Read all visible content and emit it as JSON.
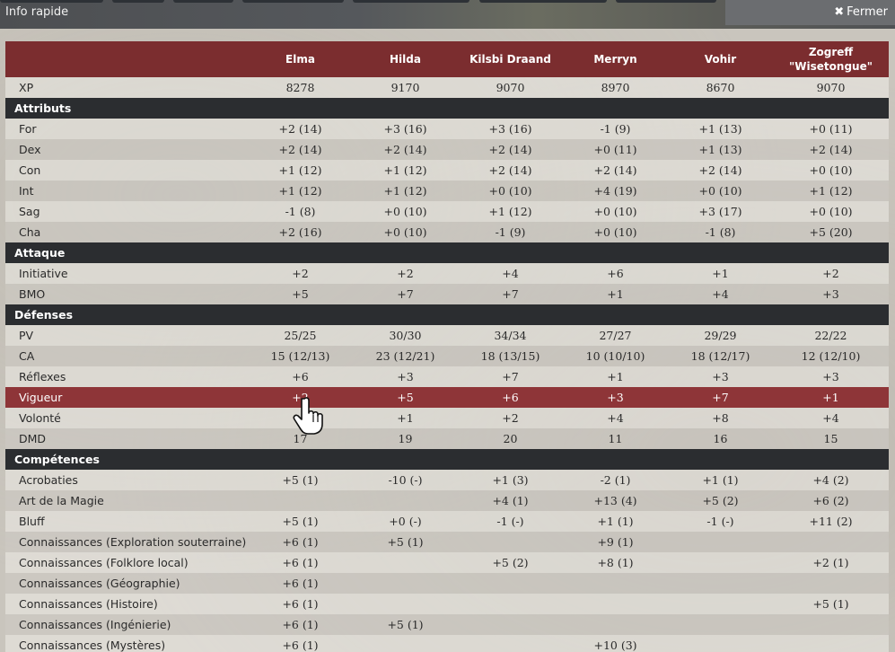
{
  "window": {
    "title": "Info rapide",
    "close_label": "Fermer"
  },
  "table": {
    "columns": [
      "Elma",
      "Hilda",
      "Kilsbi Draand",
      "Merryn",
      "Vohir",
      "Zogreff \"Wisetongue\""
    ],
    "rows": [
      {
        "type": "data",
        "label": "XP",
        "values": [
          "8278",
          "9170",
          "9070",
          "8970",
          "8670",
          "9070"
        ]
      },
      {
        "type": "section",
        "label": "Attributs"
      },
      {
        "type": "data",
        "label": "For",
        "values": [
          "+2 (14)",
          "+3 (16)",
          "+3 (16)",
          "-1 (9)",
          "+1 (13)",
          "+0 (11)"
        ]
      },
      {
        "type": "data",
        "label": "Dex",
        "values": [
          "+2 (14)",
          "+2 (14)",
          "+2 (14)",
          "+0 (11)",
          "+1 (13)",
          "+2 (14)"
        ]
      },
      {
        "type": "data",
        "label": "Con",
        "values": [
          "+1 (12)",
          "+1 (12)",
          "+2 (14)",
          "+2 (14)",
          "+2 (14)",
          "+0 (10)"
        ]
      },
      {
        "type": "data",
        "label": "Int",
        "values": [
          "+1 (12)",
          "+1 (12)",
          "+0 (10)",
          "+4 (19)",
          "+0 (10)",
          "+1 (12)"
        ]
      },
      {
        "type": "data",
        "label": "Sag",
        "values": [
          "-1 (8)",
          "+0 (10)",
          "+1 (12)",
          "+0 (10)",
          "+3 (17)",
          "+0 (10)"
        ]
      },
      {
        "type": "data",
        "label": "Cha",
        "values": [
          "+2 (16)",
          "+0 (10)",
          "-1 (9)",
          "+0 (10)",
          "-1 (8)",
          "+5 (20)"
        ]
      },
      {
        "type": "section",
        "label": "Attaque"
      },
      {
        "type": "data",
        "label": "Initiative",
        "values": [
          "+2",
          "+2",
          "+4",
          "+6",
          "+1",
          "+2"
        ]
      },
      {
        "type": "data",
        "label": "BMO",
        "values": [
          "+5",
          "+7",
          "+7",
          "+1",
          "+4",
          "+3"
        ]
      },
      {
        "type": "section",
        "label": "Défenses"
      },
      {
        "type": "data",
        "label": "PV",
        "values": [
          "25/25",
          "30/30",
          "34/34",
          "27/27",
          "29/29",
          "22/22"
        ]
      },
      {
        "type": "data",
        "label": "CA",
        "values": [
          "15 (12/13)",
          "23 (12/21)",
          "18 (13/15)",
          "10 (10/10)",
          "18 (12/17)",
          "12 (12/10)"
        ]
      },
      {
        "type": "data",
        "label": "Réflexes",
        "values": [
          "+6",
          "+3",
          "+7",
          "+1",
          "+3",
          "+3"
        ]
      },
      {
        "type": "data",
        "label": "Vigueur",
        "highlight": true,
        "values": [
          "+2",
          "+5",
          "+6",
          "+3",
          "+7",
          "+1"
        ]
      },
      {
        "type": "data",
        "label": "Volonté",
        "values": [
          "",
          "+1",
          "+2",
          "+4",
          "+8",
          "+4"
        ]
      },
      {
        "type": "data",
        "label": "DMD",
        "values": [
          "17",
          "19",
          "20",
          "11",
          "16",
          "15"
        ]
      },
      {
        "type": "section",
        "label": "Compétences"
      },
      {
        "type": "data",
        "label": "Acrobaties",
        "values": [
          "+5 (1)",
          "-10 (-)",
          "+1 (3)",
          "-2 (1)",
          "+1 (1)",
          "+4 (2)"
        ]
      },
      {
        "type": "data",
        "label": "Art de la Magie",
        "values": [
          "",
          "",
          "+4 (1)",
          "+13 (4)",
          "+5 (2)",
          "+6 (2)"
        ]
      },
      {
        "type": "data",
        "label": "Bluff",
        "values": [
          "+5 (1)",
          "+0 (-)",
          "-1 (-)",
          "+1 (1)",
          "-1 (-)",
          "+11 (2)"
        ]
      },
      {
        "type": "data",
        "label": "Connaissances (Exploration souterraine)",
        "values": [
          "+6 (1)",
          "+5 (1)",
          "",
          "+9 (1)",
          "",
          ""
        ]
      },
      {
        "type": "data",
        "label": "Connaissances (Folklore local)",
        "values": [
          "+6 (1)",
          "",
          "+5 (2)",
          "+8 (1)",
          "",
          "+2 (1)"
        ]
      },
      {
        "type": "data",
        "label": "Connaissances (Géographie)",
        "values": [
          "+6 (1)",
          "",
          "",
          "",
          "",
          ""
        ]
      },
      {
        "type": "data",
        "label": "Connaissances (Histoire)",
        "values": [
          "+6 (1)",
          "",
          "",
          "",
          "",
          "+5 (1)"
        ]
      },
      {
        "type": "data",
        "label": "Connaissances (Ingénierie)",
        "values": [
          "+6 (1)",
          "+5 (1)",
          "",
          "",
          "",
          ""
        ]
      },
      {
        "type": "data",
        "label": "Connaissances (Mystères)",
        "values": [
          "+6 (1)",
          "",
          "",
          "+10 (3)",
          "",
          ""
        ]
      }
    ]
  },
  "icons": {
    "close": "close-x-icon",
    "cursor": "hand-pointer-icon"
  },
  "colors": {
    "header": "#7b2d2f",
    "section": "#2b2d30",
    "highlight": "#8e3538"
  }
}
